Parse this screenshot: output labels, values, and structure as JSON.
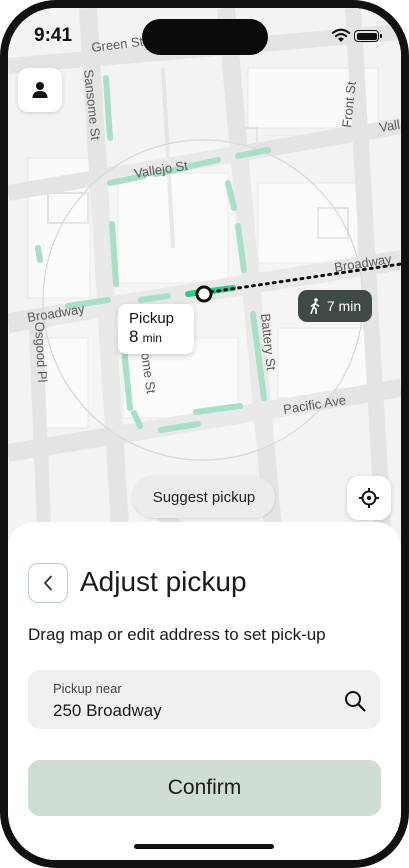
{
  "status_bar": {
    "time": "9:41"
  },
  "map": {
    "streets": {
      "green": "Green St",
      "sansome_top": "Sansome St",
      "vallejo": "Vallejo St",
      "vallejo_right": "Vall",
      "front": "Front St",
      "broadway_left": "Broadway",
      "broadway_right": "Broadway",
      "osgood": "Osgood Pl",
      "sansome_bottom": "Sansome St",
      "battery": "Battery St",
      "pacific": "Pacific Ave"
    },
    "pickup_marker": {
      "title": "Pickup",
      "minutes": "8",
      "unit": "min"
    },
    "walk_badge": {
      "icon": "walking-person-icon",
      "text": "7 min"
    },
    "suggest_label": "Suggest pickup",
    "colors": {
      "route_accent": "#2ecc8a",
      "street_highlight": "#a8dfc7"
    }
  },
  "sheet": {
    "title": "Adjust pickup",
    "subtitle": "Drag map or edit address to set pick-up",
    "address": {
      "label": "Pickup near",
      "value": "250 Broadway"
    },
    "confirm_label": "Confirm",
    "colors": {
      "confirm_bg": "#cfddd3",
      "back_border": "#b8cfc6"
    }
  }
}
